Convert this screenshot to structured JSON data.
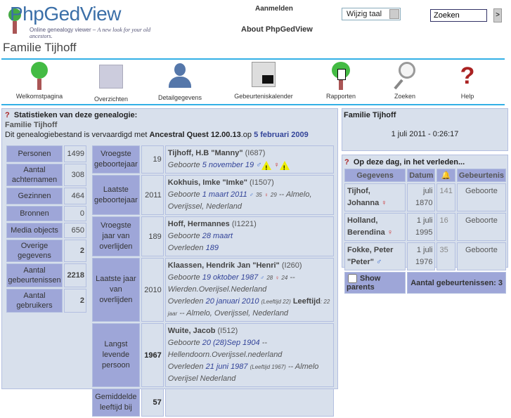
{
  "header": {
    "logo": "PhpGedView",
    "tagline": "Online genealogy viewer – ",
    "tagline_script": "A new look for your old ancestors.",
    "login": "Aanmelden",
    "about": "About PhpGedView",
    "language_select": "Wijzig taal",
    "search_value": "Zoeken",
    "search_go": ">"
  },
  "page_title": "Familie Tijhoff",
  "nav": [
    {
      "label": "Welkomstpagina"
    },
    {
      "label": "Overzichten"
    },
    {
      "label": "Detailgegevens"
    },
    {
      "label": "Gebeurteniskalender"
    },
    {
      "label": "Rapporten"
    },
    {
      "label": "Zoeken"
    },
    {
      "label": "Help"
    }
  ],
  "stats": {
    "title": "Statistieken van deze genealogie:",
    "subtitle": "Familie Tijhoff",
    "intro": "Dit genealogiebestand is vervaardigd met ",
    "software": "Ancestral Quest 12.00.13",
    "intro2": ".op ",
    "date": "5 februari 2009",
    "counts": [
      {
        "label": "Personen",
        "value": "1499"
      },
      {
        "label": "Aantal achternamen",
        "value": "308"
      },
      {
        "label": "Gezinnen",
        "value": "464"
      },
      {
        "label": "Bronnen",
        "value": "0"
      },
      {
        "label": "Media objects",
        "value": "650"
      },
      {
        "label": "Overige gegevens",
        "value": "2"
      },
      {
        "label": "Aantal gebeurtenissen",
        "value": "2218"
      },
      {
        "label": "Aantal gebruikers",
        "value": "2"
      }
    ],
    "records": [
      {
        "label": "Vroegste geboortejaar",
        "value": "19",
        "name": "Tijhoff, H.B \"Manny\"",
        "id": "(I687)",
        "l1": "Geboorte ",
        "d1": "5 november 19",
        "tail": ""
      },
      {
        "label": "Laatste geboortejaar",
        "value": "2011",
        "name": "Kokhuis, Imke \"Imke\"",
        "id": "(I1507)",
        "l1": "Geboorte ",
        "d1": "1 maart 2011",
        "m": "35",
        "f": "29",
        "tail": "-- Almelo, Overijssel, Nederland"
      },
      {
        "label": "Vroegste jaar van overlijden",
        "value": "189",
        "name": "Hoff, Hermannes",
        "id": "(I1221)",
        "l1": "Geboorte ",
        "d1": "28 maart",
        "l2": "Overleden ",
        "d2": "189"
      },
      {
        "label": "Laatste jaar van overlijden",
        "value": "2010",
        "name": "Klaassen, Hendrik Jan \"Henri\"",
        "id": "(I260)",
        "l1": "Geboorte ",
        "d1": "19 oktober 1987",
        "m": "28",
        "f": "24",
        "tail": "-- Wierden.Overijsel.Nederland",
        "l2": "Overleden ",
        "d2": "20 januari 2010",
        "age": "(Leeftijd 22)",
        "agelbl": "Leeftijd",
        "agetxt": ": 22 jaar",
        "tail2": "-- Almelo, Overijssel, Nederland"
      },
      {
        "label": "Langst levende persoon",
        "value": "1967",
        "name": "Wuite, Jacob",
        "id": "(I512)",
        "l1": "Geboorte ",
        "d1": "20 (28)Sep 1904",
        "tail": "-- Hellendoorn.Overijssel.nederland",
        "l2": "Overleden ",
        "d2": "21 juni 1987",
        "age": "(Leeftijd 1967)",
        "tail2": "-- Almelo Overijsel Nederland"
      },
      {
        "label": "Gemiddelde leeftijd bij",
        "value": "57"
      }
    ]
  },
  "clock": {
    "title": "Familie Tijhoff",
    "datetime": "1 juli 2011 - 0:26:17"
  },
  "today": {
    "title": "Op deze dag, in het verleden...",
    "headers": [
      "Gegevens",
      "Datum",
      "Gebeurtenis"
    ],
    "rows": [
      {
        "name": "Tijhof, Johanna",
        "sex": "♀",
        "date1": "juli",
        "date2": "1870",
        "years": "141",
        "event": "Geboorte"
      },
      {
        "name": "Holland, Berendina",
        "sex": "♀",
        "date1": "1 juli",
        "date2": "1995",
        "years": "16",
        "event": "Geboorte"
      },
      {
        "name": "Fokke, Peter \"Peter\"",
        "sex": "♂",
        "date1": "1 juli",
        "date2": "1976",
        "years": "35",
        "event": "Geboorte"
      }
    ],
    "show_parents": "Show parents",
    "total": "Aantal gebeurtenissen: 3"
  }
}
